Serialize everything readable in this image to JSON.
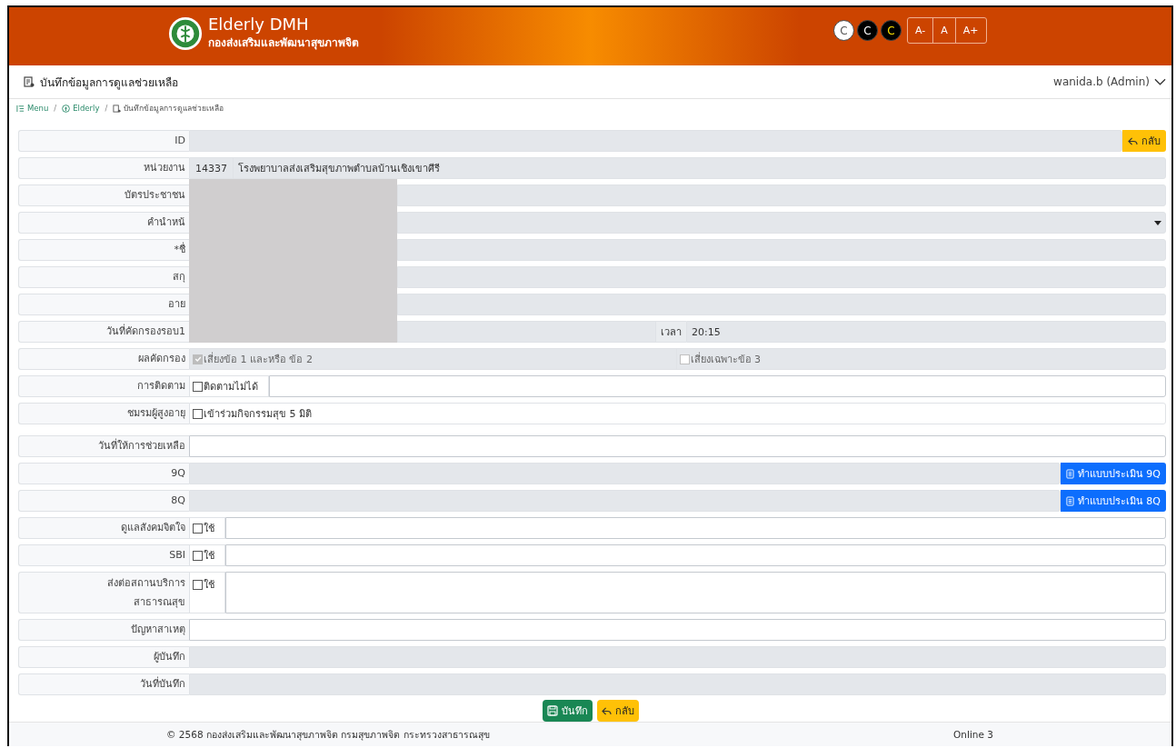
{
  "header": {
    "title": "Elderly DMH",
    "subtitle": "กองส่งเสริมและพัฒนาสุขภาพจิต",
    "contrast_buttons": [
      {
        "label": "C",
        "kind": "normal"
      },
      {
        "label": "C",
        "kind": "dark"
      },
      {
        "label": "C",
        "kind": "yellow"
      }
    ],
    "font_buttons": [
      "A-",
      "A",
      "A+"
    ]
  },
  "page_title": "บันทึกข้อมูลการดูแลช่วยเหลือ",
  "user_menu": "wanida.b (Admin)",
  "breadcrumb": [
    {
      "label": "Menu",
      "kind": "menu"
    },
    {
      "separator": "/",
      "label": "Elderly",
      "kind": "elderly"
    },
    {
      "separator": "/",
      "label": "บันทึกข้อมูลการดูแลช่วยเหลือ",
      "kind": "page"
    }
  ],
  "form_sections": [
    {
      "rows": [
        {
          "label": "ID",
          "kind": "input",
          "readonly": true,
          "button": {
            "label": "กลับ",
            "kind": "back"
          }
        },
        {
          "label": "หน่วยงาน",
          "kind": "input",
          "readonly": true,
          "prefix": "14337",
          "value": "โรงพยาบาลส่งเสริมสุขภาพตำบลบ้านเชิงเขาศีรี"
        },
        {
          "label": "บัตรประชาชน",
          "kind": "input",
          "readonly": true,
          "redacted": true
        },
        {
          "label": "คำนำหน้",
          "kind": "select",
          "readonly": true,
          "redacted": true
        },
        {
          "label": "*ชื่",
          "kind": "input",
          "readonly": true,
          "redacted": true
        },
        {
          "label": "สกุ",
          "kind": "input",
          "readonly": true,
          "redacted": true
        },
        {
          "label": "อาย",
          "kind": "input",
          "readonly": true,
          "redacted": true
        },
        {
          "label": "วันที่คัดกรองรอบ1",
          "kind": "time",
          "readonly": true,
          "redacted": true,
          "addon": "เวลา",
          "addon_value": "20:15"
        },
        {
          "label": "ผลคัดกรอง",
          "kind": "check-pair",
          "readonly": true,
          "checks": [
            {
              "label": "เสี่ยงข้อ 1 และหรือ ข้อ 2",
              "checked": true,
              "disabled": true
            },
            {
              "label": "เสี่ยงเฉพาะข้อ 3",
              "checked": false,
              "disabled": true
            }
          ]
        },
        {
          "label": "การติดตาม",
          "kind": "check-input",
          "readonly": false,
          "checks": [
            {
              "label": "ติดตามไม่ได้",
              "checked": false,
              "disabled": false
            }
          ]
        },
        {
          "label": "ชมรมผู้สูงอายุ",
          "kind": "check-only",
          "readonly": false,
          "checks": [
            {
              "label": "เข้าร่วมกิจกรรมสุข 5 มิติ",
              "checked": false,
              "disabled": false
            }
          ]
        }
      ]
    },
    {
      "rows": [
        {
          "label": "วันที่ให้การช่วยเหลือ",
          "kind": "input",
          "readonly": false
        },
        {
          "label": "9Q",
          "kind": "input",
          "readonly": true,
          "button": {
            "label": "ทำแบบประเมิน 9Q",
            "kind": "assess"
          }
        },
        {
          "label": "8Q",
          "kind": "input",
          "readonly": true,
          "button": {
            "label": "ทำแบบประเมิน 8Q",
            "kind": "assess"
          }
        },
        {
          "label": "ดูแลสังคมจิตใจ",
          "kind": "check-input",
          "readonly": false,
          "checks": [
            {
              "label": "ใช้",
              "checked": false,
              "disabled": false
            }
          ]
        },
        {
          "label": "SBI",
          "kind": "check-input",
          "readonly": false,
          "checks": [
            {
              "label": "ใช้",
              "checked": false,
              "disabled": false
            }
          ]
        },
        {
          "label": "ส่งต่อสถานบริการสาธารณสุข",
          "kind": "check-textarea",
          "readonly": false,
          "checks": [
            {
              "label": "ใช้",
              "checked": false,
              "disabled": false
            }
          ]
        },
        {
          "label": "ปัญหาสาเหตุ",
          "kind": "input",
          "readonly": false
        },
        {
          "label": "ผู้บันทึก",
          "kind": "input",
          "readonly": true
        },
        {
          "label": "วันที่บันทึก",
          "kind": "input",
          "readonly": true
        }
      ]
    }
  ],
  "actions": [
    {
      "label": "บันทึก",
      "kind": "save"
    },
    {
      "label": "กลับ",
      "kind": "back"
    }
  ],
  "footer": {
    "copyright": "© 2568 กองส่งเสริมและพัฒนาสุขภาพจิต กรมสุขภาพจิต กระทรวงสาธารณสุข",
    "online": "Online 3"
  }
}
